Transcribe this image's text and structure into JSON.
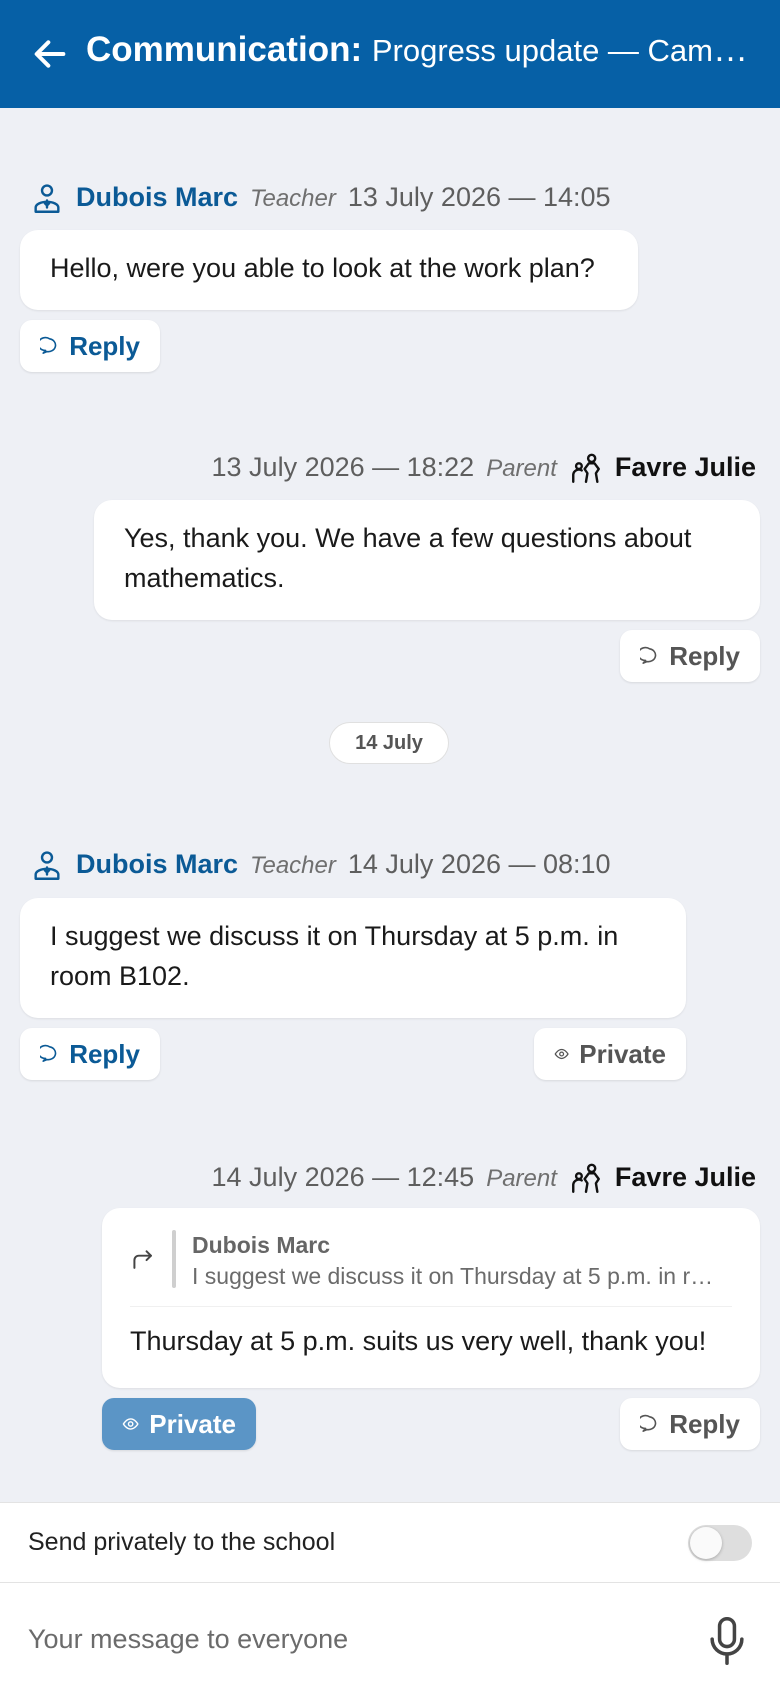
{
  "header": {
    "title_strong": "Communication:",
    "title_sub": "Progress update — Camil…"
  },
  "messages": [
    {
      "author": "Dubois Marc",
      "role": "Teacher",
      "timestamp": "13 July 2026 — 14:05",
      "text": "Hello, were you able to look at the work plan?",
      "reply_label": "Reply"
    },
    {
      "author": "Favre Julie",
      "role": "Parent",
      "timestamp": "13 July 2026 — 18:22",
      "text": "Yes, thank you. We have a few questions about mathematics.",
      "reply_label": "Reply"
    },
    {
      "author": "Dubois Marc",
      "role": "Teacher",
      "timestamp": "14 July 2026 — 08:10",
      "text": "I suggest we discuss it on Thursday at 5 p.m. in room B102.",
      "reply_label": "Reply",
      "private_label": "Private"
    },
    {
      "author": "Favre Julie",
      "role": "Parent",
      "timestamp": "14 July 2026 — 12:45",
      "quote_author": "Dubois Marc",
      "quote_text": "I suggest we discuss it on Thursday at 5 p.m. in r…",
      "text": "Thursday at 5 p.m. suits us very well, thank you!",
      "private_label": "Private",
      "reply_label": "Reply"
    }
  ],
  "day_separator": "14 July",
  "footer": {
    "toggle_label": "Send privately to the school",
    "toggle_on": false,
    "input_placeholder": "Your message to everyone"
  },
  "colors": {
    "header": "#0660a6",
    "accent": "#0b5a96",
    "private_active": "#5b95c6",
    "background": "#eef0f5"
  },
  "icons": {
    "back": "arrow-left-icon",
    "teacher": "teacher-person-icon",
    "parent": "parent-family-icon",
    "reply": "speech-bubble-icon",
    "private": "eye-icon",
    "forward": "forward-arrow-icon",
    "mic": "microphone-icon"
  }
}
